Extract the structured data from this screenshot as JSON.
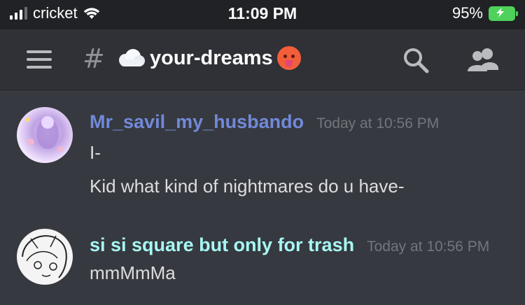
{
  "status_bar": {
    "carrier": "cricket",
    "time": "11:09 PM",
    "battery": "95%"
  },
  "header": {
    "channel_prefix": "#",
    "channel_name": "your-dreams"
  },
  "icons": {
    "menu": "hamburger-icon",
    "search": "search-icon",
    "members": "members-icon"
  },
  "colors": {
    "background": "#36393f",
    "header": "#2f3136",
    "user1": "#7289da",
    "user2": "#a7f7f4",
    "battery": "#4fd15b"
  },
  "messages": [
    {
      "username": "Mr_savil_my_husbando",
      "timestamp": "Today at 10:56 PM",
      "lines": [
        "I-",
        "Kid what kind of nightmares do u have-"
      ]
    },
    {
      "username": "si si square but only for trash",
      "timestamp": "Today at 10:56 PM",
      "lines": [
        "mmMmMa"
      ]
    }
  ]
}
